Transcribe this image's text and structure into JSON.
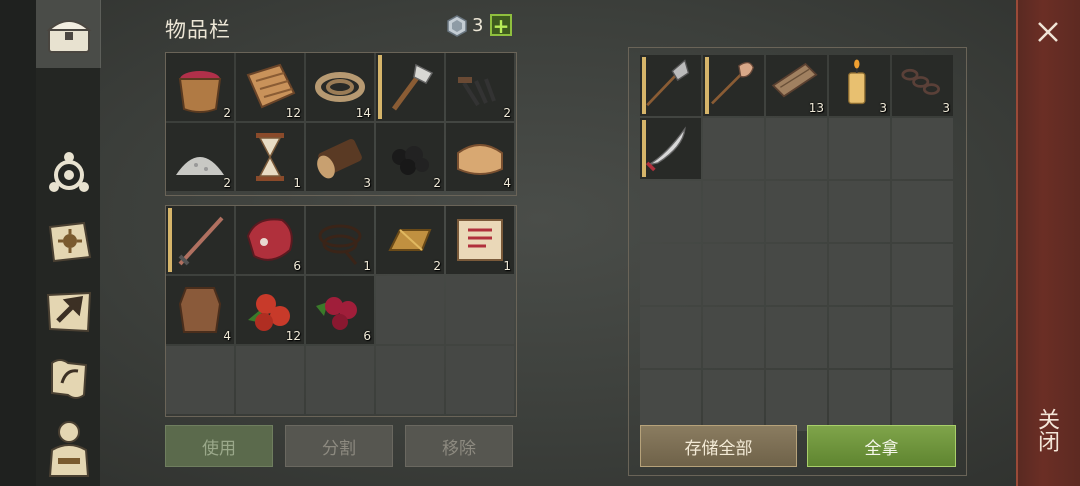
{
  "inventory": {
    "title": "物品栏",
    "gem_count": "3",
    "slots_top": [
      {
        "icon": "berry-basket-icon",
        "qty": "2"
      },
      {
        "icon": "fabric-icon",
        "qty": "12"
      },
      {
        "icon": "rope-icon",
        "qty": "14"
      },
      {
        "icon": "stone-axe-icon",
        "qty": ""
      },
      {
        "icon": "nails-icon",
        "qty": "2"
      },
      {
        "icon": "sand-pile-icon",
        "qty": "2"
      },
      {
        "icon": "hourglass-icon",
        "qty": "1"
      },
      {
        "icon": "log-icon",
        "qty": "3"
      },
      {
        "icon": "coal-icon",
        "qty": "2"
      },
      {
        "icon": "cloth-bolt-icon",
        "qty": "4"
      }
    ],
    "slots_bottom": [
      {
        "icon": "sword-icon",
        "qty": ""
      },
      {
        "icon": "raw-meat-icon",
        "qty": "6"
      },
      {
        "icon": "whip-icon",
        "qty": "1"
      },
      {
        "icon": "gold-ingot-icon",
        "qty": "2"
      },
      {
        "icon": "blueprint-scroll-icon",
        "qty": "1"
      },
      {
        "icon": "leather-hide-icon",
        "qty": "4"
      },
      {
        "icon": "red-berries-icon",
        "qty": "12"
      },
      {
        "icon": "cranberries-icon",
        "qty": "6"
      }
    ],
    "buttons": {
      "use": "使用",
      "split": "分割",
      "remove": "移除"
    }
  },
  "storage": {
    "slots": [
      {
        "icon": "halberd-icon",
        "qty": ""
      },
      {
        "icon": "shovel-icon",
        "qty": ""
      },
      {
        "icon": "plank-icon",
        "qty": "13"
      },
      {
        "icon": "candle-icon",
        "qty": "3"
      },
      {
        "icon": "chain-icon",
        "qty": "3"
      },
      {
        "icon": "scimitar-icon",
        "qty": ""
      }
    ],
    "buttons": {
      "store_all": "存储全部",
      "take_all": "全拿"
    }
  },
  "close_label": "关闭",
  "colors": {
    "accent_green": "#8fbf3e",
    "durability": "#d6b56a",
    "close_strip": "#6b2e25"
  }
}
